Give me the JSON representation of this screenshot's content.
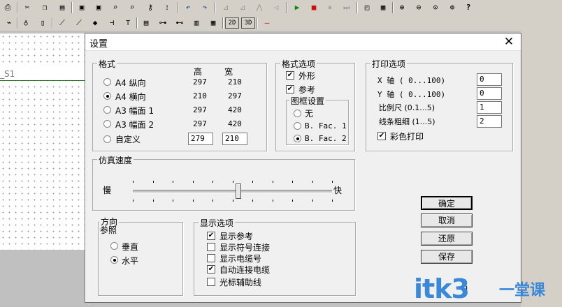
{
  "toolbar1": {
    "icons": [
      "print-icon",
      "cut-icon",
      "copy-icon",
      "paste-icon",
      "component-icon",
      "component-edit-icon",
      "zoom-icon",
      "zoom2-icon",
      "key-icon",
      "grid-icon",
      "undo-icon",
      "redo-icon",
      "align1-icon",
      "align2-icon",
      "mirror1-icon",
      "mirror2-icon",
      "play-icon",
      "stop-icon",
      "pause-icon",
      "step-icon",
      "window-icon",
      "cascade-icon",
      "zoom-in-icon",
      "zoom-out-icon",
      "zoom-fit-icon",
      "zoom-area-icon",
      "help-icon"
    ]
  },
  "toolbar2": {
    "icons": [
      "t2-a-icon",
      "t2-b-icon",
      "t2-c-icon",
      "t2-d-icon",
      "t2-e-icon",
      "t2-f-icon",
      "t2-g-icon",
      "t2-h-icon",
      "t2-i-icon",
      "t2-j-icon",
      "t2-k-icon",
      "t2-l-icon",
      "t2-m-icon",
      "t2-n-icon",
      "t2-o-icon",
      "t2-p-icon"
    ],
    "labels": {
      "btn2d": "2D",
      "btn3d": "3D"
    }
  },
  "sheet": {
    "tab_label": "_S1"
  },
  "dialog": {
    "title": "设置",
    "close_glyph": "✕",
    "format": {
      "label": "格式",
      "col_high": "高",
      "col_wide": "宽",
      "rows": [
        {
          "label": "A4 纵向",
          "high": "297",
          "wide": "210",
          "selected": false
        },
        {
          "label": "A4 横向",
          "high": "210",
          "wide": "297",
          "selected": true
        },
        {
          "label": "A3 幅面 1",
          "high": "297",
          "wide": "420",
          "selected": false
        },
        {
          "label": "A3 幅面 2",
          "high": "297",
          "wide": "420",
          "selected": false
        }
      ],
      "custom_label": "自定义",
      "custom_high": "279",
      "custom_wide": "210"
    },
    "format_options": {
      "label": "格式选项",
      "outline": "外形",
      "reference": "参考",
      "frame_label": "图框设置",
      "frame_none": "无",
      "frame_b1": "B. Fac. 1",
      "frame_b2": "B. Fac. 2"
    },
    "print_options": {
      "label": "打印选项",
      "x_axis": "X 轴 ( 0...100)",
      "x_value": "0",
      "y_axis": "Y 轴 ( 0...100)",
      "y_value": "0",
      "scale": "比例尺 (0.1...5)",
      "scale_value": "1",
      "line_width": "线条粗细 (1...5)",
      "line_width_value": "2",
      "color_print": "彩色打印"
    },
    "sim_speed": {
      "label": "仿真速度",
      "slow": "慢",
      "fast": "快",
      "level": 0.53
    },
    "direction": {
      "label": "方向",
      "sub": "参照",
      "vertical": "垂直",
      "horizontal": "水平"
    },
    "display": {
      "label": "显示选项",
      "show_ref": "显示参考",
      "show_symbol": "显示符号连接",
      "show_cable": "显示电缆号",
      "auto_cable": "自动连接电缆",
      "cursor_line": "光标辅助线"
    },
    "buttons": {
      "ok": "确定",
      "cancel": "取消",
      "restore": "还原",
      "save": "保存"
    },
    "status_zero": "0"
  },
  "watermark": {
    "text": "itk3",
    "cn": "一堂课"
  }
}
